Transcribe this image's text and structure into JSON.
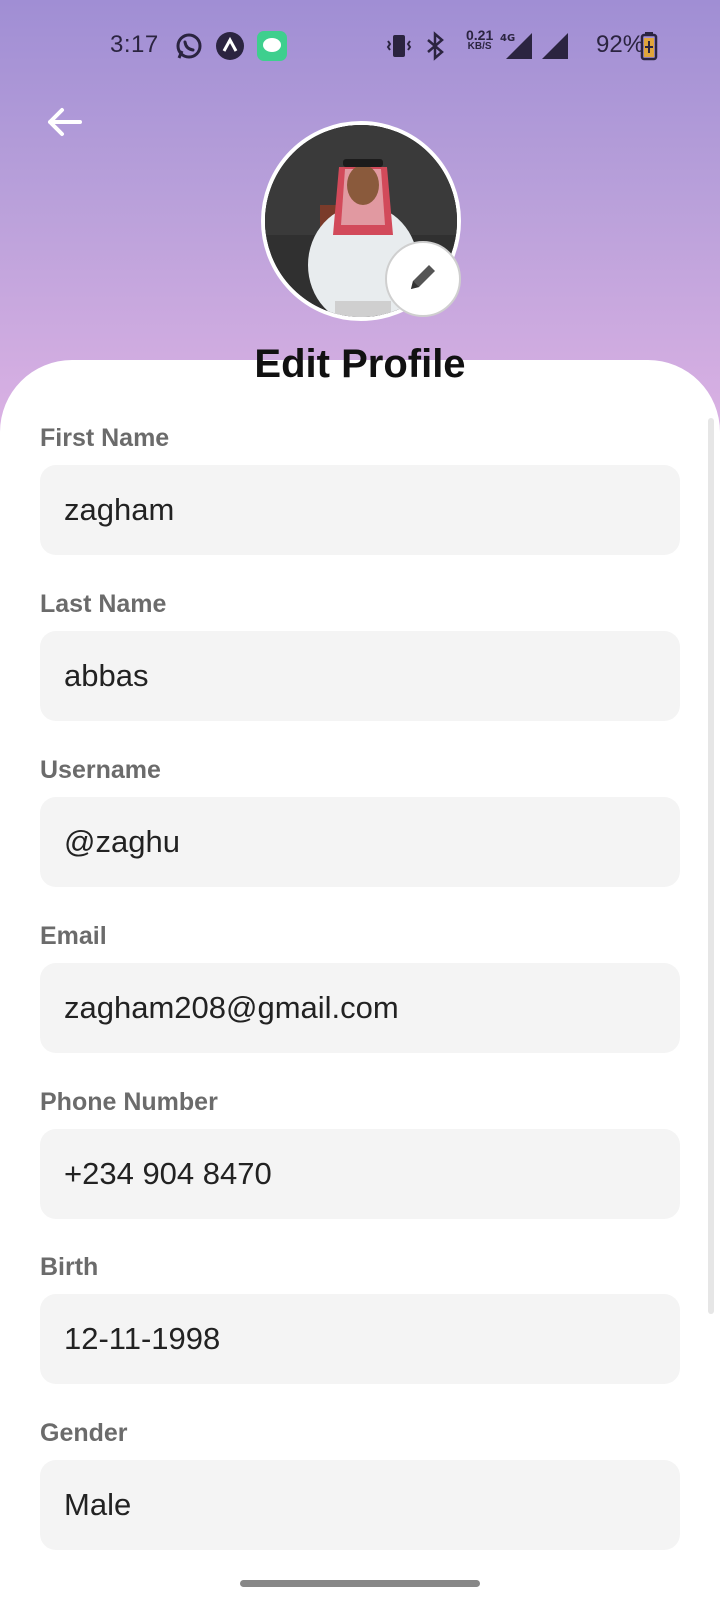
{
  "status_bar": {
    "time": "3:17",
    "speed_value": "0.21",
    "speed_unit": "KB/S",
    "network": "4G",
    "battery": "92%"
  },
  "header": {
    "title": "Edit Profile"
  },
  "form": {
    "fields": [
      {
        "label": "First Name",
        "value": "zagham"
      },
      {
        "label": "Last Name",
        "value": "abbas"
      },
      {
        "label": "Username",
        "value": "@zaghu"
      },
      {
        "label": "Email",
        "value": "zagham208@gmail.com"
      },
      {
        "label": "Phone Number",
        "value": "+234 904 8470"
      },
      {
        "label": "Birth",
        "value": "12-11-1998"
      },
      {
        "label": "Gender",
        "value": "Male"
      }
    ]
  },
  "colors": {
    "header_gradient_top": "#a08ed4",
    "header_gradient_bottom": "#dcb2e4",
    "input_bg": "#f4f4f4",
    "label": "#6b6b6b"
  },
  "icons": [
    "back-arrow-icon",
    "pencil-icon",
    "whatsapp-icon",
    "app-icon",
    "messages-icon",
    "vibrate-icon",
    "bluetooth-icon",
    "signal-icon",
    "battery-icon"
  ]
}
